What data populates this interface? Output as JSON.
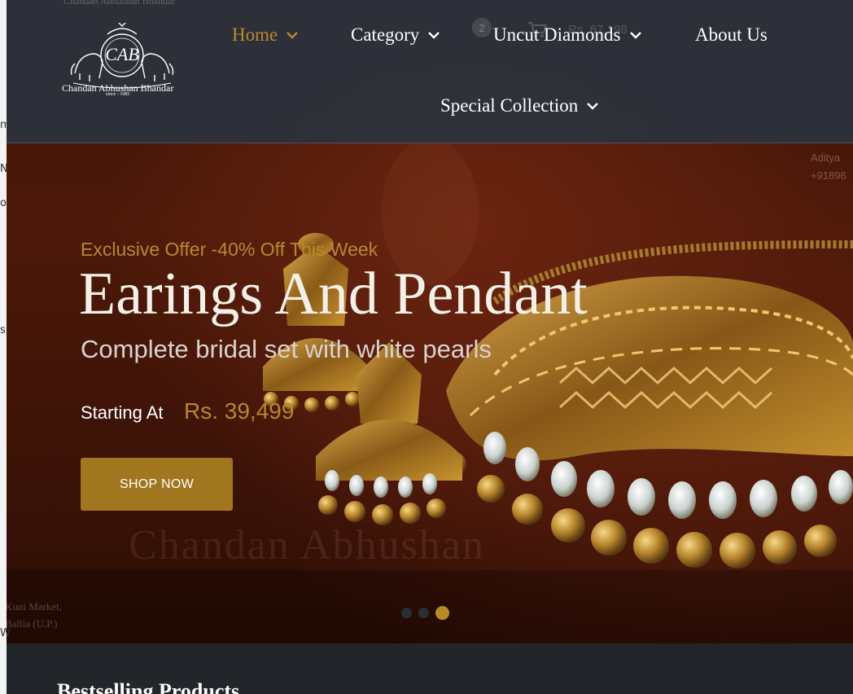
{
  "nav": {
    "logo_text": "Chandan Abhushan Bhandar",
    "logo_since": "since - 1985",
    "items": [
      {
        "label": "Home",
        "active": true,
        "dropdown": true
      },
      {
        "label": "Category",
        "active": false,
        "dropdown": true
      },
      {
        "label": "Uncut Diamonds",
        "active": false,
        "dropdown": true
      },
      {
        "label": "About Us",
        "active": false,
        "dropdown": false
      },
      {
        "label": "Special Collection",
        "active": false,
        "dropdown": true
      }
    ],
    "cart_count": "2",
    "cart_total": "Rs. 67,198",
    "ghost_brand": "Chandan Abhushan Bhandar"
  },
  "hero": {
    "offer": "Exclusive Offer -40% Off This Week",
    "title": "Earings And Pendant",
    "subtitle": "Complete bridal set with white pearls",
    "starting_label": "Starting At",
    "price": "Rs. 39,499",
    "shop_button": "SHOP NOW",
    "slides": 3,
    "active_slide": 3,
    "watermark": "Chandan Abhushan",
    "watermark_address_1": "Kuni Market,",
    "watermark_address_2": "Ballia (U.P.)",
    "watermark_right_1": "Aditya",
    "watermark_right_2": "+91896"
  },
  "section": {
    "title": "Bestselling Products"
  },
  "colors": {
    "accent": "#b98a2e",
    "button": "#a0771f",
    "nav_bg": "#2c323a",
    "page_bg": "#222529"
  },
  "icons": {
    "dropdown": "chevron-down-icon",
    "cart": "cart-icon"
  }
}
